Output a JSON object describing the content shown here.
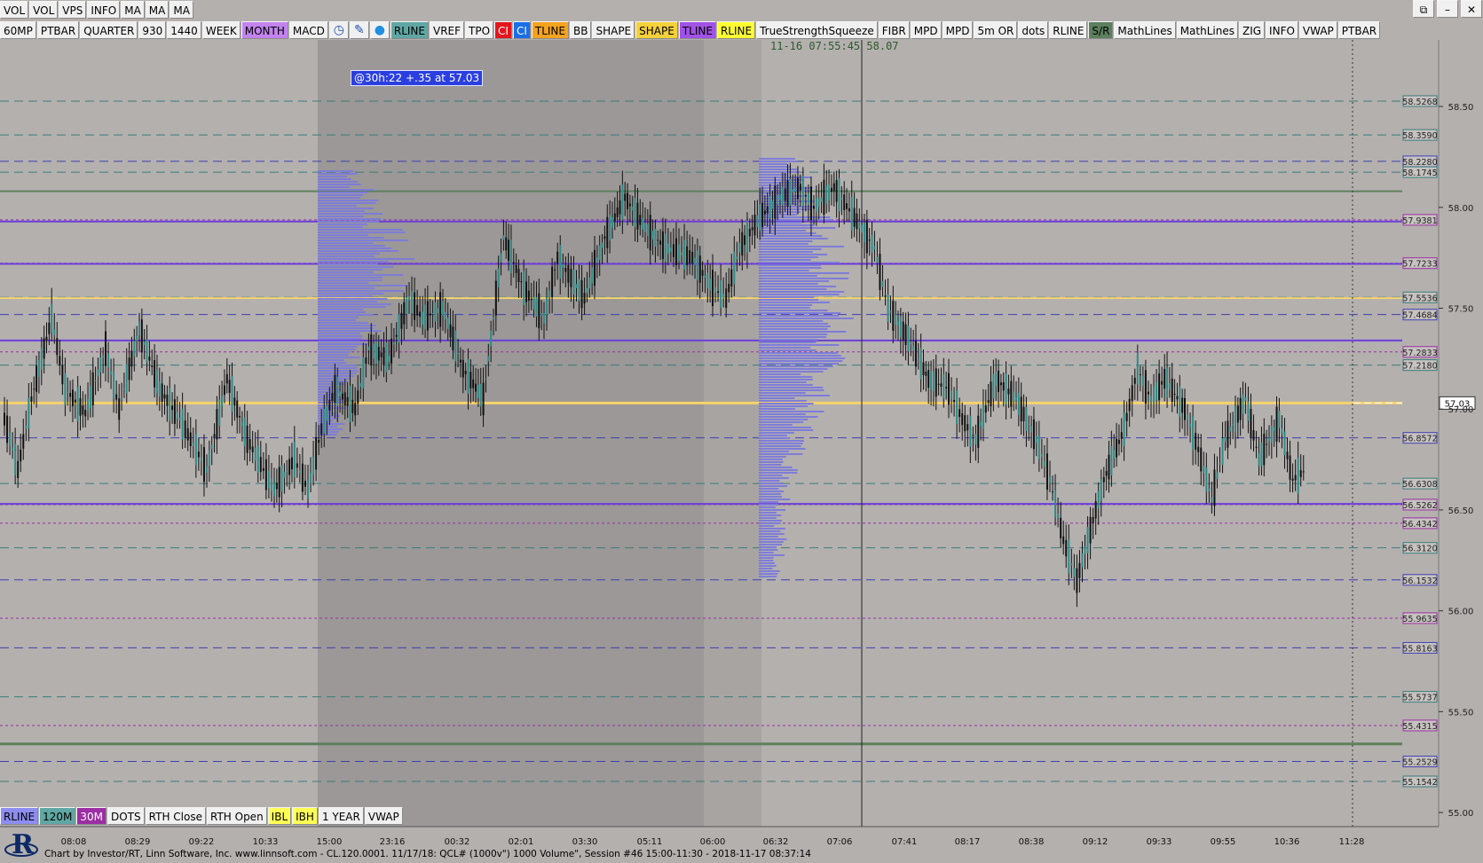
{
  "topbar_primary": [
    "VOL",
    "VOL",
    "VPS",
    "INFO",
    "MA",
    "MA",
    "MA"
  ],
  "window_controls": [
    "restore",
    "minimize",
    "close"
  ],
  "toolbar": [
    {
      "label": "60MP",
      "bg": "#f0f0f0"
    },
    {
      "label": "PTBAR",
      "bg": "#f0f0f0"
    },
    {
      "label": "QUARTER",
      "bg": "#f0f0f0"
    },
    {
      "label": "930",
      "bg": "#f0f0f0"
    },
    {
      "label": "1440",
      "bg": "#f0f0f0"
    },
    {
      "label": "WEEK",
      "bg": "#f0f0f0"
    },
    {
      "label": "MONTH",
      "bg": "#c283ee"
    },
    {
      "label": "MACD",
      "bg": "#f0f0f0"
    },
    {
      "icon": "clock-icon"
    },
    {
      "icon": "pencil-icon"
    },
    {
      "icon": "drop-icon"
    },
    {
      "label": "RLINE",
      "bg": "#5fa7a4"
    },
    {
      "label": "VREF",
      "bg": "#f0f0f0"
    },
    {
      "label": "TPO",
      "bg": "#f0f0f0"
    },
    {
      "label": "CI",
      "bg": "#e3161c",
      "fg": "#ffffff"
    },
    {
      "label": "CI",
      "bg": "#1b6ee8",
      "fg": "#ffffff"
    },
    {
      "label": "TLINE",
      "bg": "#f5a21e"
    },
    {
      "label": "BB",
      "bg": "#f0f0f0"
    },
    {
      "label": "SHAPE",
      "bg": "#f0f0f0"
    },
    {
      "label": "SHAPE",
      "bg": "#f4d13a"
    },
    {
      "label": "TLINE",
      "bg": "#a152e6"
    },
    {
      "label": "RLINE",
      "bg": "#ffff33"
    },
    {
      "label": "TrueStrengthSqueeze",
      "bg": "#f0f0f0"
    },
    {
      "label": "FIBR",
      "bg": "#f0f0f0"
    },
    {
      "label": "MPD",
      "bg": "#f0f0f0"
    },
    {
      "label": "MPD",
      "bg": "#f0f0f0"
    },
    {
      "label": "5m OR",
      "bg": "#f0f0f0"
    },
    {
      "label": "dots",
      "bg": "#f0f0f0"
    },
    {
      "label": "RLINE",
      "bg": "#f0f0f0"
    },
    {
      "label": "S/R",
      "bg": "#5d7f5d"
    },
    {
      "label": "MathLines",
      "bg": "#f0f0f0"
    },
    {
      "label": "MathLines",
      "bg": "#f0f0f0"
    },
    {
      "label": "ZIG",
      "bg": "#f0f0f0"
    },
    {
      "label": "INFO",
      "bg": "#f0f0f0"
    },
    {
      "label": "VWAP",
      "bg": "#f0f0f0"
    },
    {
      "label": "PTBAR",
      "bg": "#f0f0f0"
    }
  ],
  "bottom_toolbar": [
    {
      "label": "RLINE",
      "bg": "#8d8df0"
    },
    {
      "label": "120M",
      "bg": "#5fa7a4"
    },
    {
      "label": "30M",
      "bg": "#9c2ea3"
    },
    {
      "label": "DOTS",
      "bg": "#f0f0f0"
    },
    {
      "label": "RTH Close",
      "bg": "#f0f0f0"
    },
    {
      "label": "RTH Open",
      "bg": "#f0f0f0"
    },
    {
      "label": "IBL",
      "bg": "#ffff55"
    },
    {
      "label": "IBH",
      "bg": "#ffff55"
    },
    {
      "label": "1 YEAR",
      "bg": "#f0f0f0"
    },
    {
      "label": "VWAP",
      "bg": "#f0f0f0"
    }
  ],
  "crosshair_readout": {
    "datetime": "11-16 07:55:45",
    "price": "58.07"
  },
  "note_tag": "@30h:22  +.35 at 57.03",
  "footer_text": "Chart by Investor/RT, Linn Software, Inc. www.linnsoft.com - CL.120.0001.  11/17/18: QCL# (1000v\") 1000 Volume\", Session #46 15:00-11:30 - 2018-11-17 08:37:14",
  "chart_data": {
    "type": "candlestick",
    "y_axis_ticks": [
      "58.50",
      "58.00",
      "57.50",
      "57.00",
      "56.50",
      "56.00",
      "55.50",
      "55.00"
    ],
    "x_axis_ticks": [
      "08:08",
      "08:29",
      "09:22",
      "10:33",
      "15:00",
      "23:16",
      "00:32",
      "02:01",
      "03:30",
      "05:11",
      "06:00",
      "06:32",
      "07:06",
      "07:41",
      "08:17",
      "08:38",
      "09:12",
      "09:33",
      "09:55",
      "10:36",
      "11:28"
    ],
    "ylim": [
      54.93,
      58.83
    ],
    "last_price": "57.03",
    "price_levels": [
      {
        "label": "58.5268",
        "value": 58.5268,
        "color": "#3a7d7a",
        "style": "dash"
      },
      {
        "label": "58.3590",
        "value": 58.359,
        "color": "#3a7d7a",
        "style": "dash"
      },
      {
        "label": "58.2280",
        "value": 58.228,
        "color": "#3f3fb0",
        "style": "dash"
      },
      {
        "label": "58.1745",
        "value": 58.1745,
        "color": "#3a7d7a",
        "style": "dash"
      },
      {
        "label": "57.9381",
        "value": 57.9381,
        "color": "#9c2ea3",
        "style": "dot"
      },
      {
        "label": "57.7233",
        "value": 57.7233,
        "color": "#9c2ea3",
        "style": "dot"
      },
      {
        "label": "57.5536",
        "value": 57.5536,
        "color": "#3a7d7a",
        "style": "dash"
      },
      {
        "label": "57.4684",
        "value": 57.4684,
        "color": "#3f3fb0",
        "style": "dash"
      },
      {
        "label": "57.2833",
        "value": 57.2833,
        "color": "#9c2ea3",
        "style": "dot"
      },
      {
        "label": "57.2180",
        "value": 57.218,
        "color": "#3a7d7a",
        "style": "dash"
      },
      {
        "label": "56.8572",
        "value": 56.8572,
        "color": "#3f3fb0",
        "style": "dash"
      },
      {
        "label": "56.6308",
        "value": 56.6308,
        "color": "#3a7d7a",
        "style": "dash"
      },
      {
        "label": "56.5262",
        "value": 56.5262,
        "color": "#9c2ea3",
        "style": "dot"
      },
      {
        "label": "56.4342",
        "value": 56.4342,
        "color": "#9c2ea3",
        "style": "dot"
      },
      {
        "label": "56.3120",
        "value": 56.312,
        "color": "#3a7d7a",
        "style": "dash"
      },
      {
        "label": "56.1532",
        "value": 56.1532,
        "color": "#3f3fb0",
        "style": "dash"
      },
      {
        "label": "55.9635",
        "value": 55.9635,
        "color": "#9c2ea3",
        "style": "dot"
      },
      {
        "label": "55.8163",
        "value": 55.8163,
        "color": "#3f3fb0",
        "style": "dash"
      },
      {
        "label": "55.5737",
        "value": 55.5737,
        "color": "#3a7d7a",
        "style": "dash"
      },
      {
        "label": "55.4315",
        "value": 55.4315,
        "color": "#9c2ea3",
        "style": "dot"
      },
      {
        "label": "55.2529",
        "value": 55.2529,
        "color": "#3f3fb0",
        "style": "dash"
      },
      {
        "label": "55.1542",
        "value": 55.1542,
        "color": "#3a7d7a",
        "style": "dash"
      }
    ],
    "extra_lines": [
      {
        "value": 58.08,
        "color": "#5d7f5d",
        "width": 2
      },
      {
        "value": 57.93,
        "color": "#6a3fd9",
        "width": 2
      },
      {
        "value": 57.72,
        "color": "#6a3fd9",
        "width": 2
      },
      {
        "value": 57.55,
        "color": "#f6d36b",
        "width": 2
      },
      {
        "value": 57.34,
        "color": "#6a3fd9",
        "width": 2
      },
      {
        "value": 57.03,
        "color": "#f6d36b",
        "width": 3
      },
      {
        "value": 56.53,
        "color": "#6a3fd9",
        "width": 2
      },
      {
        "value": 55.34,
        "color": "#5d7f5d",
        "width": 3
      }
    ],
    "series_path": [
      [
        0,
        56.95
      ],
      [
        0.01,
        56.7
      ],
      [
        0.02,
        57.05
      ],
      [
        0.035,
        57.45
      ],
      [
        0.045,
        57.1
      ],
      [
        0.06,
        56.98
      ],
      [
        0.075,
        57.3
      ],
      [
        0.085,
        57.0
      ],
      [
        0.1,
        57.4
      ],
      [
        0.115,
        57.1
      ],
      [
        0.13,
        56.95
      ],
      [
        0.15,
        56.7
      ],
      [
        0.165,
        57.15
      ],
      [
        0.18,
        56.85
      ],
      [
        0.2,
        56.6
      ],
      [
        0.215,
        56.75
      ],
      [
        0.225,
        56.6
      ],
      [
        0.235,
        56.9
      ],
      [
        0.245,
        57.1
      ],
      [
        0.26,
        57.0
      ],
      [
        0.27,
        57.3
      ],
      [
        0.285,
        57.25
      ],
      [
        0.3,
        57.55
      ],
      [
        0.31,
        57.45
      ],
      [
        0.325,
        57.5
      ],
      [
        0.34,
        57.2
      ],
      [
        0.355,
        57.05
      ],
      [
        0.37,
        57.85
      ],
      [
        0.385,
        57.6
      ],
      [
        0.4,
        57.45
      ],
      [
        0.41,
        57.75
      ],
      [
        0.43,
        57.55
      ],
      [
        0.445,
        57.85
      ],
      [
        0.46,
        58.05
      ],
      [
        0.475,
        57.9
      ],
      [
        0.49,
        57.8
      ],
      [
        0.51,
        57.75
      ],
      [
        0.525,
        57.6
      ],
      [
        0.535,
        57.55
      ],
      [
        0.545,
        57.8
      ],
      [
        0.56,
        57.95
      ],
      [
        0.575,
        58.05
      ],
      [
        0.59,
        58.1
      ],
      [
        0.6,
        58.0
      ],
      [
        0.615,
        58.1
      ],
      [
        0.63,
        57.95
      ],
      [
        0.645,
        57.8
      ],
      [
        0.655,
        57.5
      ],
      [
        0.67,
        57.35
      ],
      [
        0.685,
        57.15
      ],
      [
        0.7,
        57.1
      ],
      [
        0.71,
        56.95
      ],
      [
        0.72,
        56.85
      ],
      [
        0.735,
        57.15
      ],
      [
        0.75,
        57.05
      ],
      [
        0.765,
        56.85
      ],
      [
        0.775,
        56.65
      ],
      [
        0.785,
        56.35
      ],
      [
        0.795,
        56.15
      ],
      [
        0.805,
        56.4
      ],
      [
        0.815,
        56.65
      ],
      [
        0.83,
        56.9
      ],
      [
        0.84,
        57.2
      ],
      [
        0.85,
        57.05
      ],
      [
        0.86,
        57.15
      ],
      [
        0.875,
        57.0
      ],
      [
        0.885,
        56.8
      ],
      [
        0.895,
        56.55
      ],
      [
        0.905,
        56.85
      ],
      [
        0.92,
        57.05
      ],
      [
        0.93,
        56.75
      ],
      [
        0.945,
        56.95
      ],
      [
        0.955,
        56.65
      ],
      [
        0.965,
        56.7
      ]
    ]
  }
}
